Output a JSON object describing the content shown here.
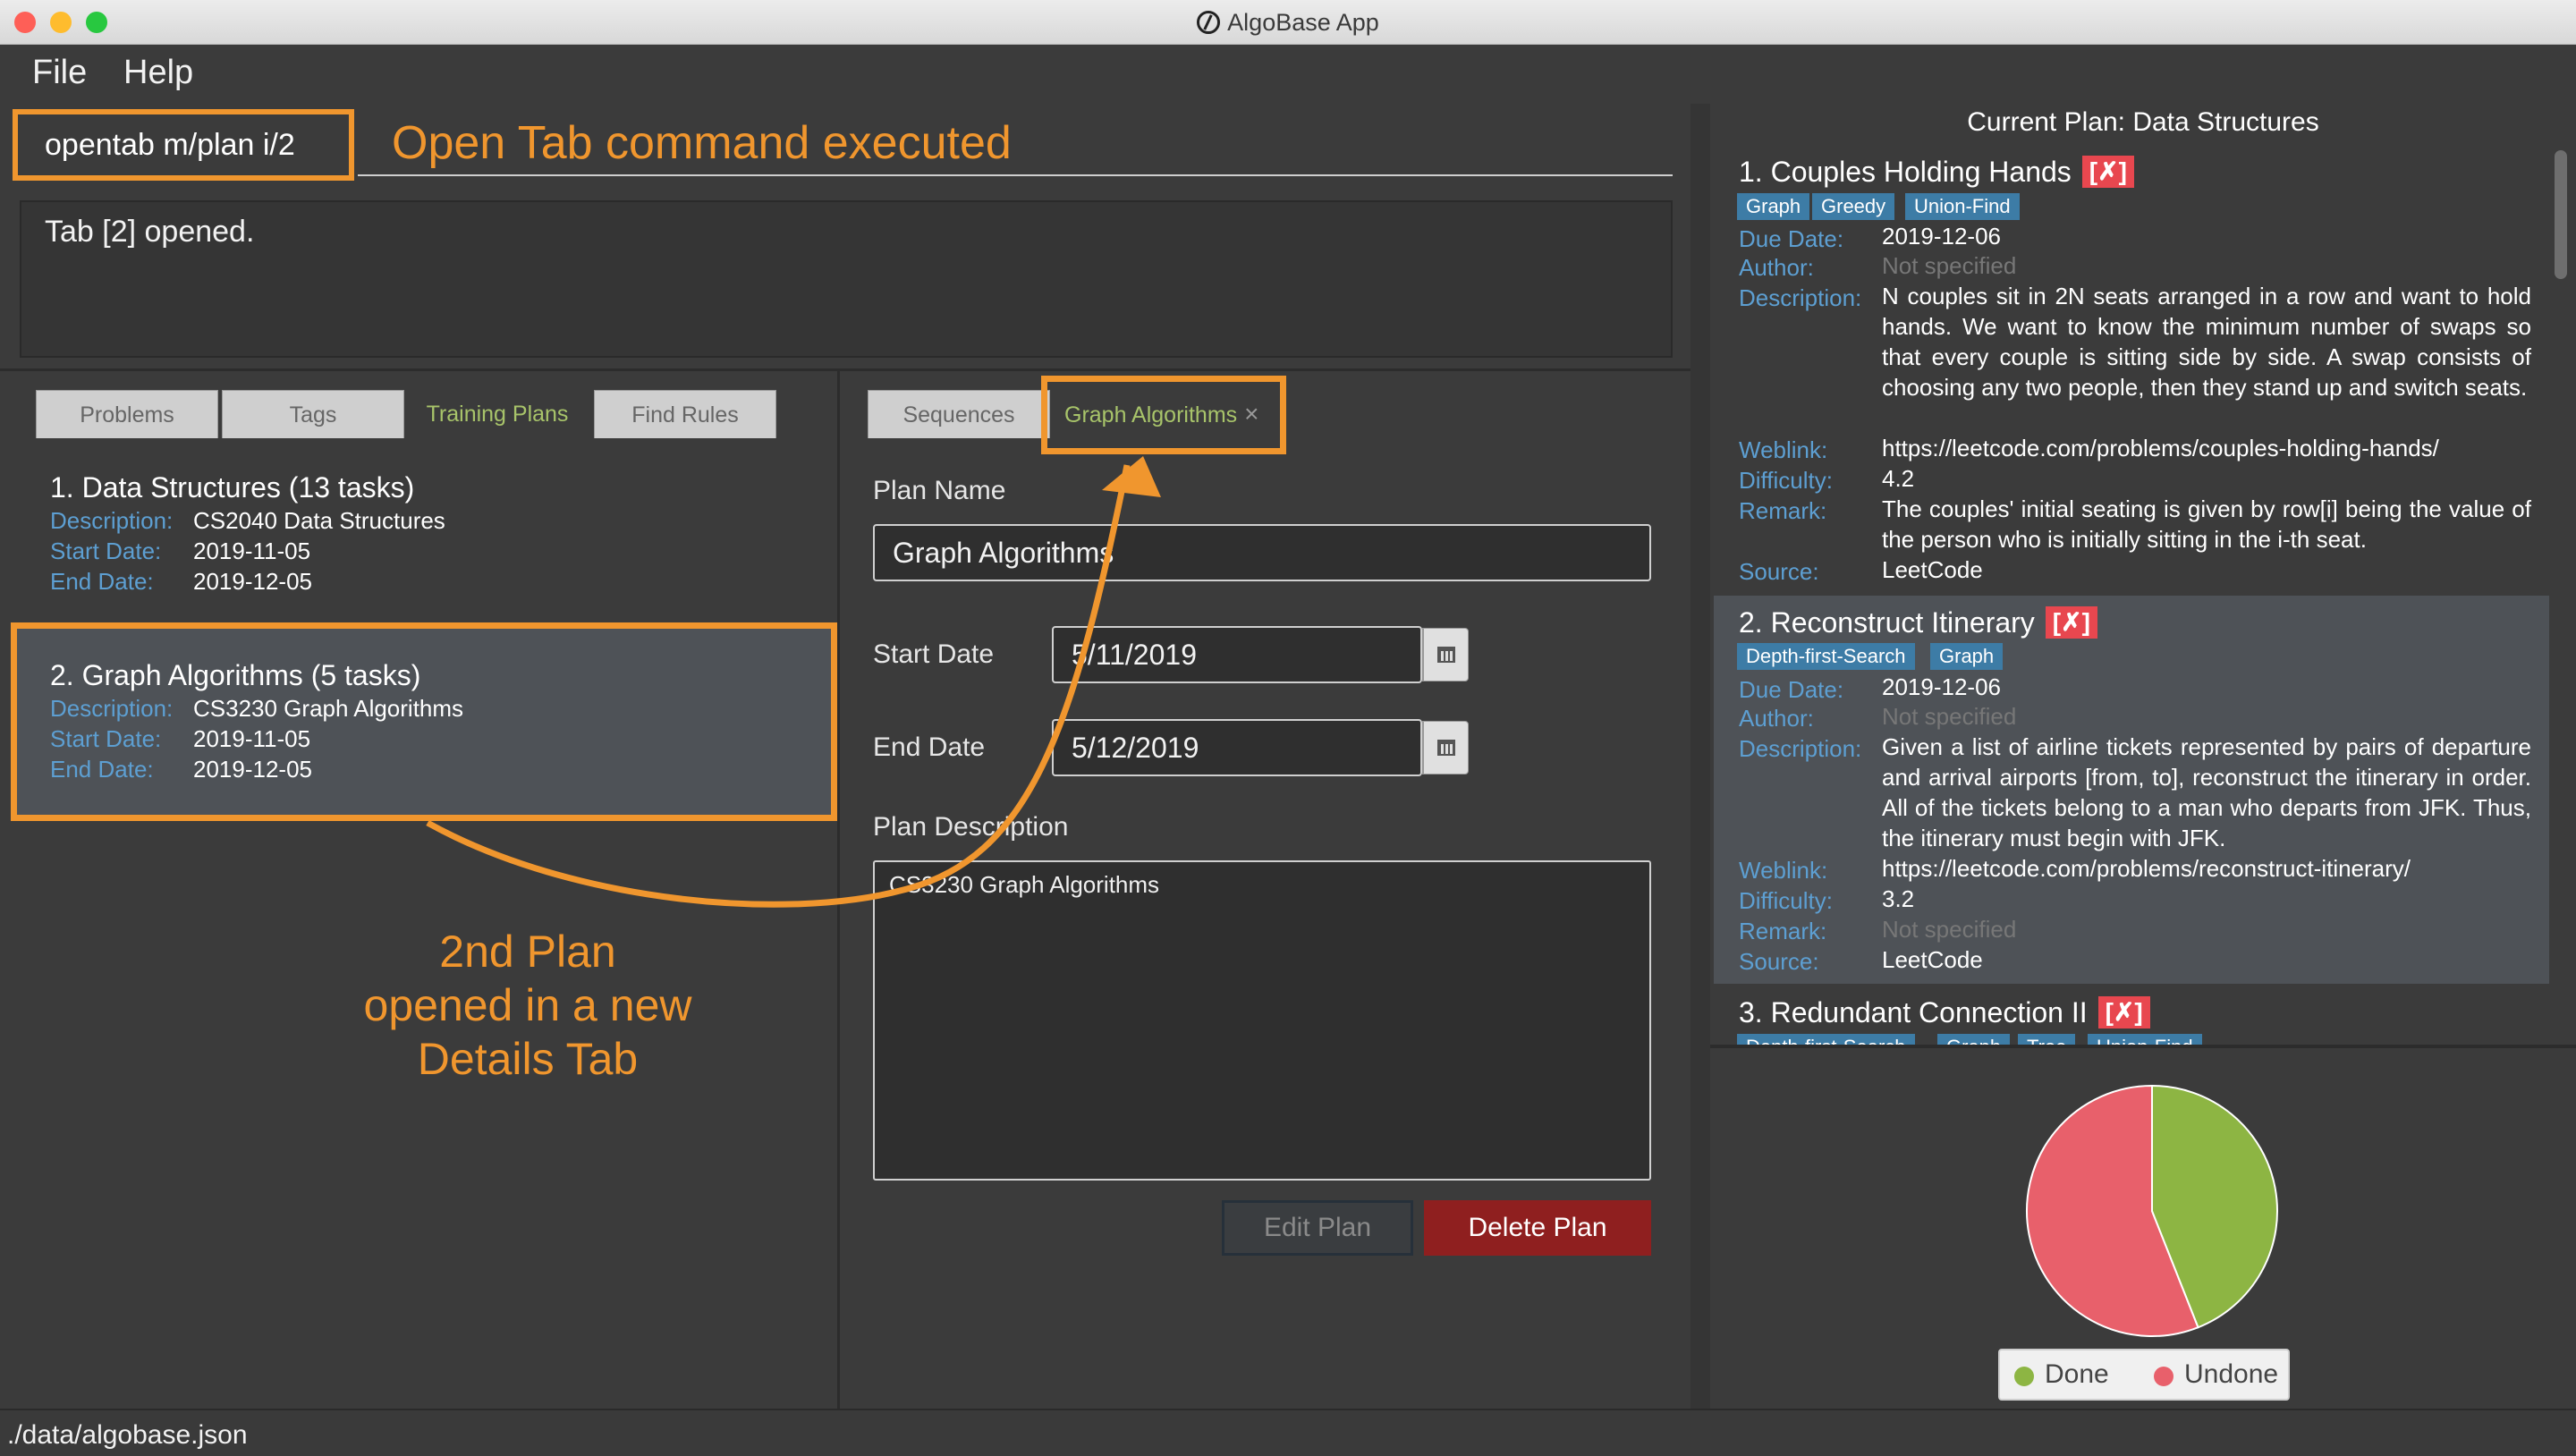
{
  "window": {
    "title": "AlgoBase App"
  },
  "menu": {
    "file": "File",
    "help": "Help"
  },
  "command": {
    "input": "opentab m/plan i/2",
    "annotation": "Open Tab command executed",
    "result": "Tab [2] opened."
  },
  "left_tabs": [
    "Problems",
    "Tags",
    "Training Plans",
    "Find Rules"
  ],
  "plans": [
    {
      "title": "1.  Data Structures (13 tasks)",
      "description": "CS2040 Data Structures",
      "start": "2019-11-05",
      "end": "2019-12-05"
    },
    {
      "title": "2.  Graph Algorithms (5 tasks)",
      "description": "CS3230 Graph Algorithms",
      "start": "2019-11-05",
      "end": "2019-12-05"
    }
  ],
  "plan_labels": {
    "description": "Description:",
    "start": "Start Date:",
    "end": "End Date:"
  },
  "left_annotation": [
    "2nd Plan",
    "opened in a new",
    "Details Tab"
  ],
  "detail_tabs": {
    "sequences": "Sequences",
    "graph": "Graph Algorithms",
    "close": "×"
  },
  "details": {
    "plan_name_label": "Plan Name",
    "plan_name": "Graph Algorithms",
    "start_label": "Start Date",
    "start": "5/11/2019",
    "end_label": "End Date",
    "end": "5/12/2019",
    "desc_label": "Plan Description",
    "desc": "CS3230 Graph Algorithms",
    "edit": "Edit Plan",
    "delete": "Delete Plan"
  },
  "current_plan": {
    "title": "Current Plan: Data Structures",
    "labels": {
      "due": "Due Date:",
      "author": "Author:",
      "description": "Description:",
      "weblink": "Weblink:",
      "difficulty": "Difficulty:",
      "remark": "Remark:",
      "source": "Source:"
    },
    "badge": "[✗]",
    "tasks": [
      {
        "title": "1.  Couples Holding Hands",
        "tags": [
          "Graph",
          "Greedy",
          "Union-Find"
        ],
        "due": "2019-12-06",
        "author": "Not specified",
        "description": "N couples sit in 2N seats arranged in a row and want to hold hands. We want to know the minimum number of swaps so that every couple is sitting side by side. A swap consists of choosing any two people, then they stand up and switch seats.",
        "weblink": "https://leetcode.com/problems/couples-holding-hands/",
        "difficulty": "4.2",
        "remark": "The couples' initial seating is given by row[i] being the value of the person who is initially sitting in the i-th seat.",
        "source": "LeetCode"
      },
      {
        "title": "2.  Reconstruct Itinerary",
        "tags": [
          "Depth-first-Search",
          "Graph"
        ],
        "due": "2019-12-06",
        "author": "Not specified",
        "description": "Given a list of airline tickets represented by pairs of departure and arrival airports [from, to], reconstruct the itinerary in order. All of the tickets belong to a man who departs from JFK. Thus, the itinerary must begin with JFK.",
        "weblink": "https://leetcode.com/problems/reconstruct-itinerary/",
        "difficulty": "3.2",
        "remark": "Not specified",
        "source": "LeetCode"
      },
      {
        "title": "3.  Redundant Connection II",
        "tags": [
          "Depth-first-Search",
          "Graph",
          "Tree",
          "Union-Find"
        ]
      }
    ]
  },
  "pie": {
    "done_fraction": 0.44,
    "done_color": "#8db543",
    "undone_color": "#e8606b"
  },
  "legend": {
    "done": "Done",
    "undone": "Undone"
  },
  "status": {
    "path": "./data/algobase.json"
  },
  "colors": {
    "accent": "#f0962e",
    "label_blue": "#5d9fd2",
    "tag_blue": "#3d7ca6",
    "badge_red": "#e8474f",
    "selected_tab_green": "#a8c46a"
  }
}
